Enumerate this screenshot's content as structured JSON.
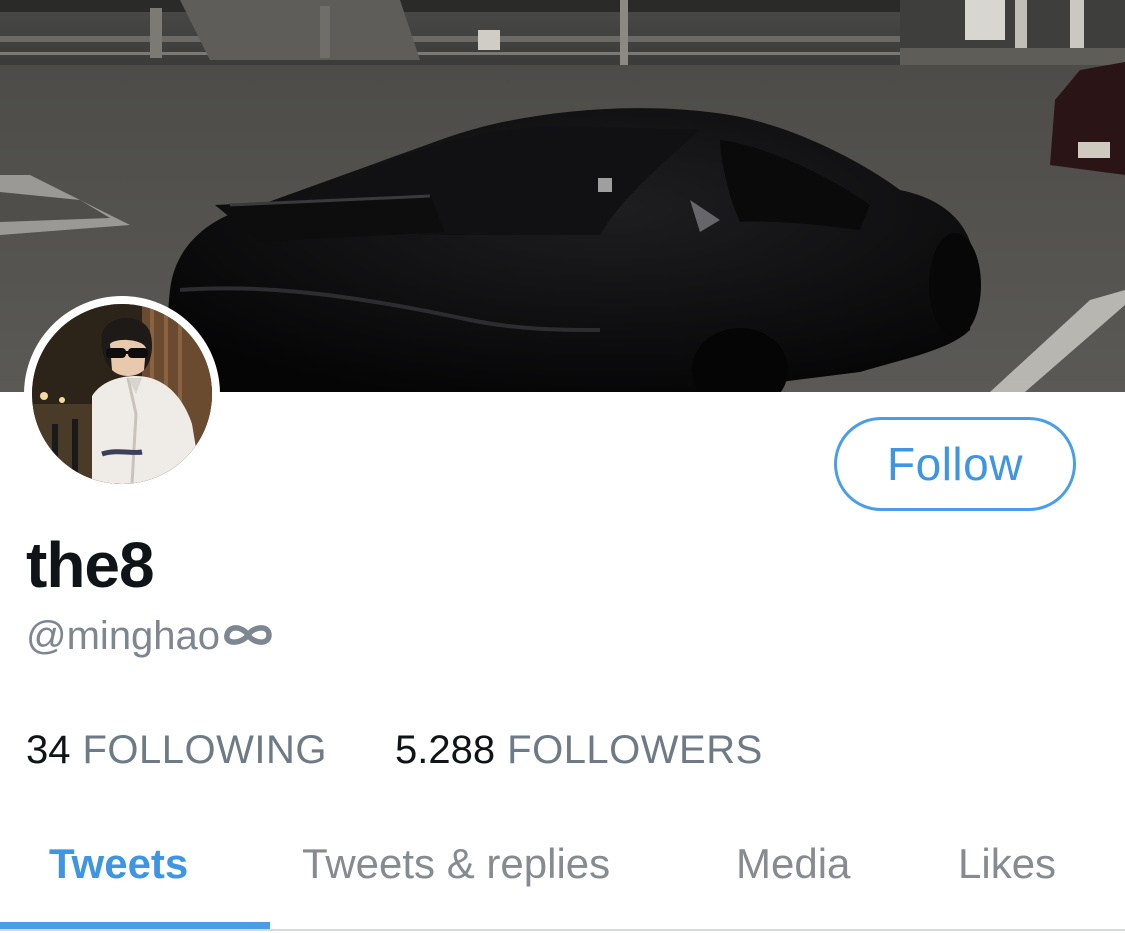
{
  "profile": {
    "display_name": "the8",
    "handle": "@minghao",
    "handle_icon": "infinity-icon"
  },
  "actions": {
    "follow_label": "Follow",
    "accent_color": "#3d95e3"
  },
  "stats": {
    "following_count": "34",
    "following_label": "FOLLOWING",
    "followers_count": "5.288",
    "followers_label": "FOLLOWERS"
  },
  "tabs": [
    {
      "label": "Tweets",
      "active": true
    },
    {
      "label": "Tweets & replies",
      "active": false
    },
    {
      "label": "Media",
      "active": false
    },
    {
      "label": "Likes",
      "active": false
    }
  ]
}
